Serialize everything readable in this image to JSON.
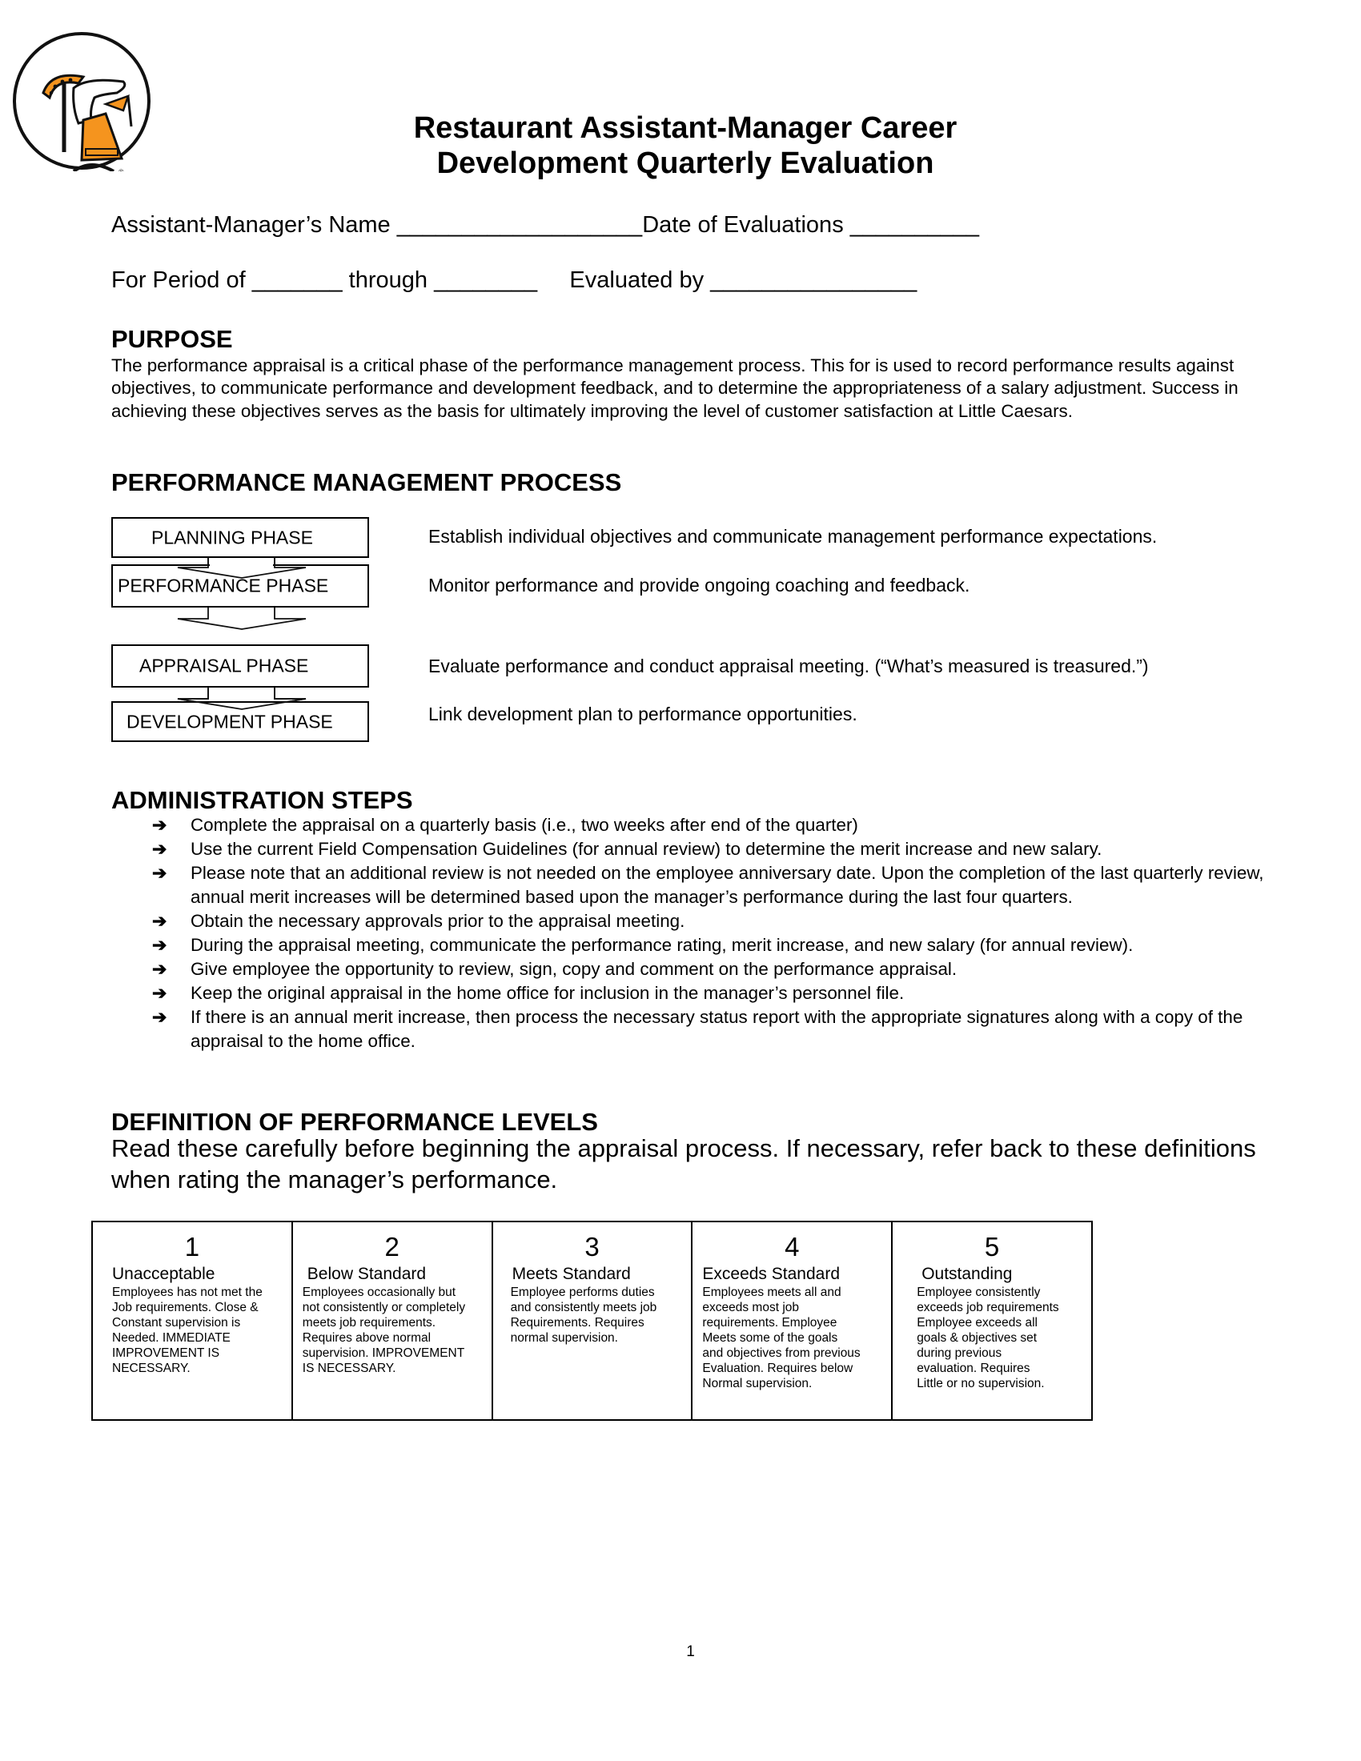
{
  "header": {
    "logo_name": "little-caesars-logo",
    "title_line1": "Restaurant Assistant-Manager Career",
    "title_line2": "Development Quarterly Evaluation"
  },
  "form": {
    "name_label": "Assistant-Manager’s Name",
    "name_value": "___________________",
    "date_label": "Date of Evaluations",
    "date_value": "__________",
    "period_label": "For Period of",
    "period_from": "_______",
    "through_label": "through",
    "period_to": "________",
    "evaluated_by_label": "Evaluated by",
    "evaluated_by_value": "________________"
  },
  "purpose": {
    "heading": "PURPOSE",
    "body": "The performance appraisal is a critical phase of the performance management process.  This for is used to record performance results against objectives, to communicate performance and development feedback, and to determine the appropriateness of a salary adjustment.  Success in achieving these objectives serves as the basis for ultimately improving the level of customer satisfaction at Little Caesars."
  },
  "process": {
    "heading": "PERFORMANCE MANAGEMENT PROCESS",
    "phases": [
      {
        "label": "PLANNING PHASE",
        "description": "Establish individual objectives and communicate management performance expectations."
      },
      {
        "label": "PERFORMANCE PHASE",
        "description": "Monitor performance and provide ongoing coaching and feedback."
      },
      {
        "label": "APPRAISAL PHASE",
        "description": "Evaluate performance and conduct appraisal meeting.  (“What’s measured is treasured.”)"
      },
      {
        "label": "DEVELOPMENT PHASE",
        "description": "Link development plan to performance opportunities."
      }
    ]
  },
  "administration": {
    "heading": "ADMINISTRATION STEPS",
    "bullet_icon": "➔",
    "steps": [
      "Complete the appraisal on a quarterly basis (i.e., two weeks after end of the quarter)",
      "Use the current Field Compensation Guidelines (for annual review) to determine the merit increase and new salary.",
      "Please note that an additional review is not needed on the employee anniversary date.  Upon the completion of the last quarterly review, annual merit increases will be determined based upon the manager’s performance during the last four quarters.",
      "Obtain the necessary approvals prior to the appraisal meeting.",
      "During the appraisal meeting, communicate the performance rating, merit increase, and new salary (for annual review).",
      "Give employee the opportunity to review, sign, copy and comment on the performance appraisal.",
      "Keep the original appraisal in the home office for inclusion in the manager’s personnel file.",
      "If there is an annual merit increase, then process the necessary status report with the appropriate signatures along with a copy of the appraisal to the home office."
    ]
  },
  "definitions": {
    "heading": "DEFINITION OF PERFORMANCE LEVELS",
    "intro": "Read these carefully before beginning the appraisal process.  If necessary, refer back to these definitions when rating the manager’s performance.",
    "levels": [
      {
        "number": "1",
        "label": "Unacceptable",
        "description": "Employees has not met the\nJob requirements.  Close &\nConstant supervision is\nNeeded.  IMMEDIATE\nIMPROVEMENT IS\nNECESSARY."
      },
      {
        "number": "2",
        "label": "Below Standard",
        "description": "Employees occasionally but\nnot consistently or completely\nmeets job requirements.\nRequires above normal\nsupervision.  IMPROVEMENT\nIS NECESSARY."
      },
      {
        "number": "3",
        "label": "Meets Standard",
        "description": "Employee performs  duties\nand consistently meets job\nRequirements. Requires\nnormal supervision."
      },
      {
        "number": "4",
        "label": "Exceeds Standard",
        "description": "Employees meets all and\nexceeds most job\nrequirements.  Employee\nMeets some of the goals\nand objectives from previous\nEvaluation.  Requires below\nNormal supervision."
      },
      {
        "number": "5",
        "label": "Outstanding",
        "description": "Employee consistently\nexceeds job requirements\nEmployee exceeds all\ngoals & objectives set\nduring previous\nevaluation.  Requires\nLittle or no supervision."
      }
    ]
  },
  "footer": {
    "page_number": "1"
  },
  "colors": {
    "logo_orange": "#F5941E",
    "text": "#000000"
  }
}
